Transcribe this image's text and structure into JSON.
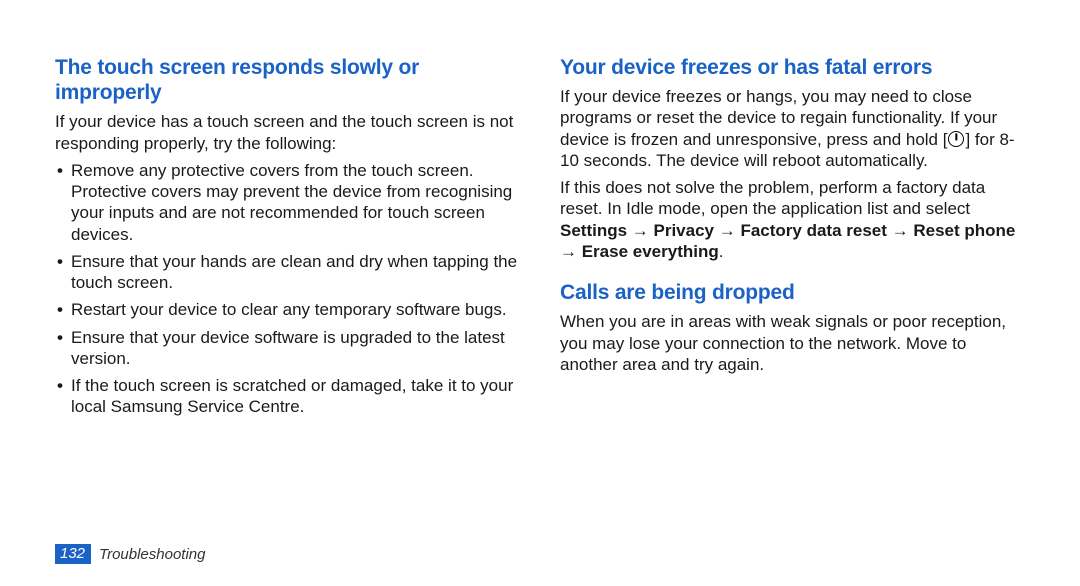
{
  "footer": {
    "page_number": "132",
    "section": "Troubleshooting"
  },
  "left": {
    "heading": "The touch screen responds slowly or improperly",
    "intro": "If your device has a touch screen and the touch screen is not responding properly, try the following:",
    "bullets": [
      "Remove any protective covers from the touch screen. Protective covers may prevent the device from recognising your inputs and are not recommended for touch screen devices.",
      "Ensure that your hands are clean and dry when tapping the touch screen.",
      "Restart your device to clear any temporary software bugs.",
      "Ensure that your device software is upgraded to the latest version.",
      "If the touch screen is scratched or damaged, take it to your local Samsung Service Centre."
    ]
  },
  "right": {
    "s1": {
      "heading": "Your device freezes or has fatal errors",
      "p1_pre": "If your device freezes or hangs, you may need to close programs or reset the device to regain functionality. If your device is frozen and unresponsive, press and hold [",
      "p1_post": "] for 8-10 seconds. The device will reboot automatically.",
      "p2_pre": "If this does not solve the problem, perform a factory data reset. In Idle mode, open the application list and select ",
      "p2_bold": "Settings → Privacy → Factory data reset → Reset phone → Erase everything",
      "p2_post": "."
    },
    "s2": {
      "heading": "Calls are being dropped",
      "body": "When you are in areas with weak signals or poor reception, you may lose your connection to the network. Move to another area and try again."
    }
  }
}
